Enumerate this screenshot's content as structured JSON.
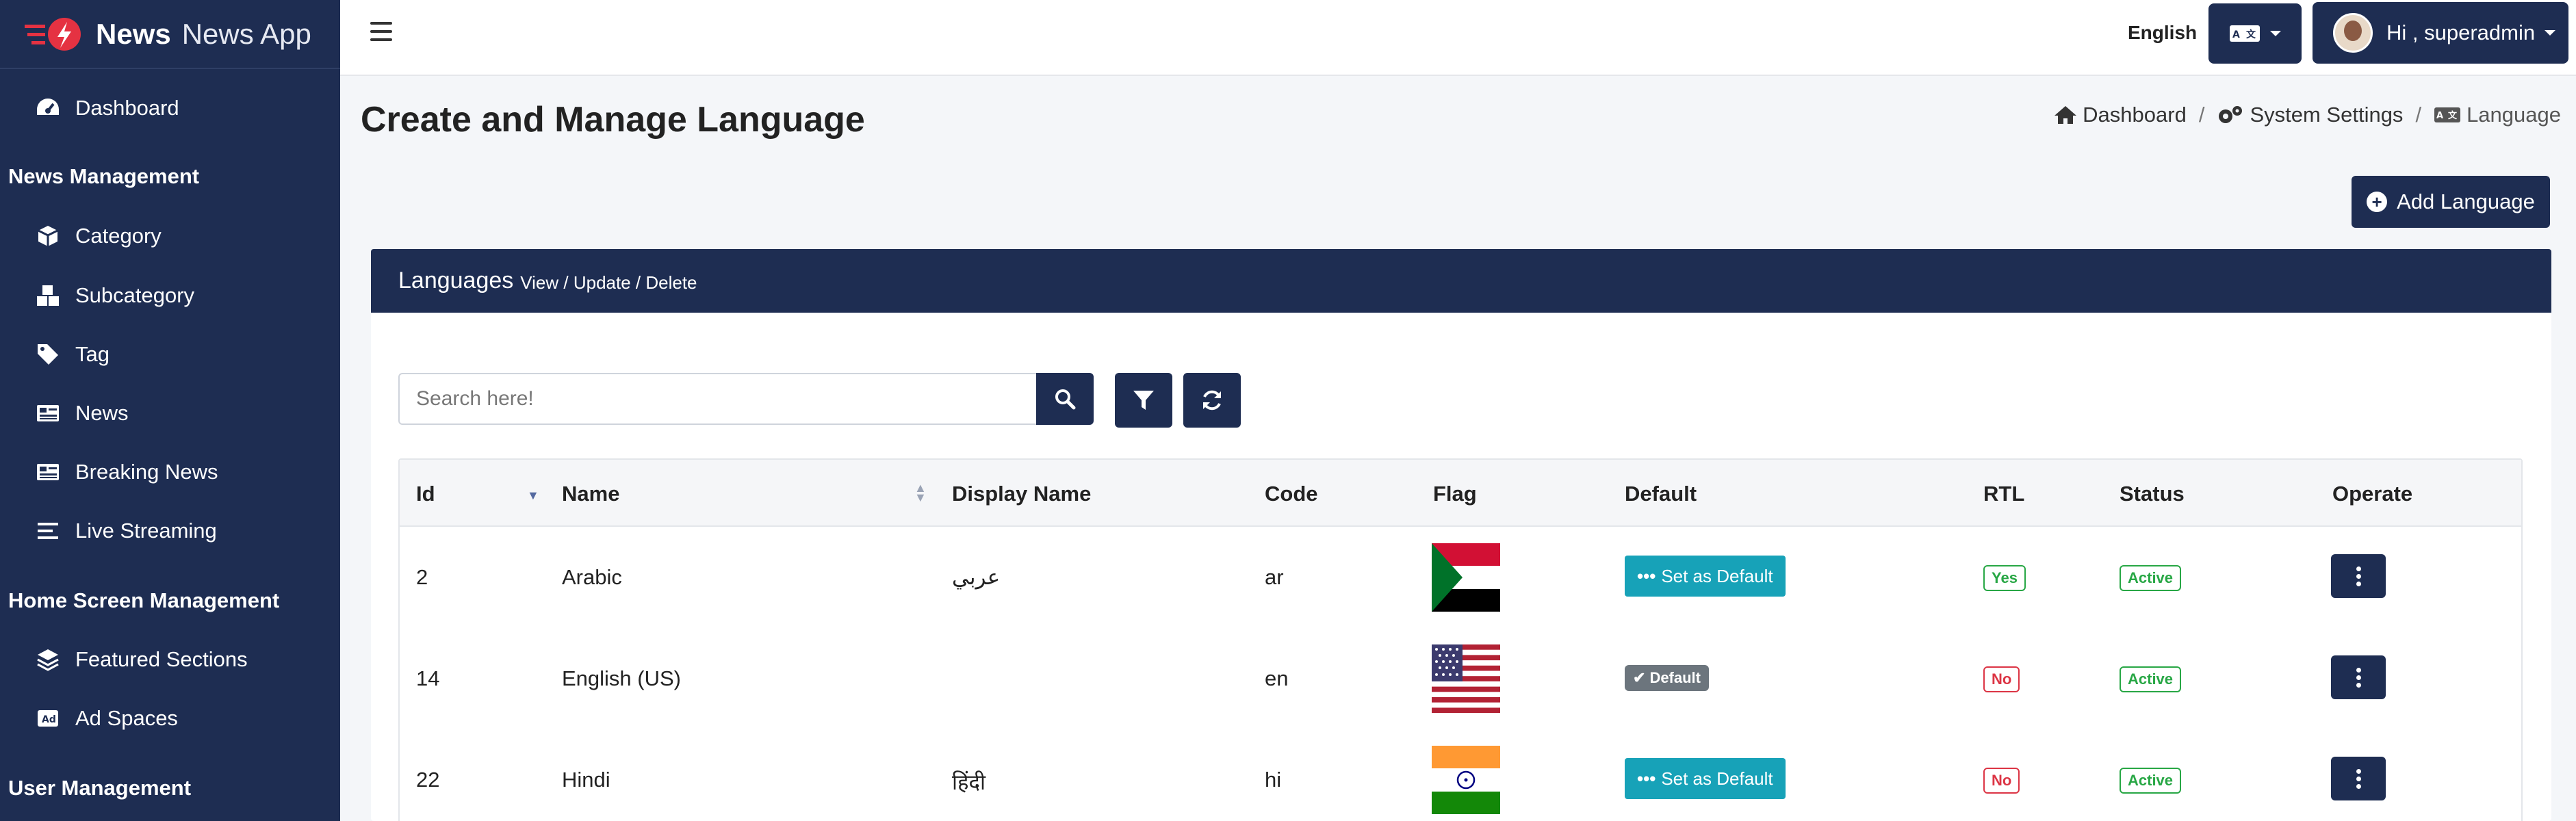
{
  "brand": {
    "name": "News",
    "subtitle": "News App"
  },
  "sidebar": {
    "items": [
      {
        "label": "Dashboard",
        "icon": "gauge-icon"
      },
      {
        "section": "News Management"
      },
      {
        "label": "Category",
        "icon": "cube-icon"
      },
      {
        "label": "Subcategory",
        "icon": "cubes-icon"
      },
      {
        "label": "Tag",
        "icon": "tag-icon"
      },
      {
        "label": "News",
        "icon": "newspaper-icon"
      },
      {
        "label": "Breaking News",
        "icon": "newspaper-icon"
      },
      {
        "label": "Live Streaming",
        "icon": "list-icon"
      },
      {
        "section": "Home Screen Management"
      },
      {
        "label": "Featured Sections",
        "icon": "layers-icon"
      },
      {
        "label": "Ad Spaces",
        "icon": "ad-icon"
      },
      {
        "section": "User Management"
      }
    ]
  },
  "topbar": {
    "language": "English",
    "user_greeting": "Hi , superadmin"
  },
  "page": {
    "title": "Create and Manage Language",
    "breadcrumb": [
      "Dashboard",
      "System Settings",
      "Language"
    ],
    "add_button": "Add Language"
  },
  "card": {
    "title": "Languages",
    "subtitle": "View / Update / Delete",
    "search_placeholder": "Search here!"
  },
  "table": {
    "columns": [
      "Id",
      "Name",
      "Display Name",
      "Code",
      "Flag",
      "Default",
      "RTL",
      "Status",
      "Operate"
    ],
    "rows": [
      {
        "id": "2",
        "name": "Arabic",
        "display_name": "عربي",
        "code": "ar",
        "flag": "sudan-flag",
        "default_label": "Set as Default",
        "is_default": false,
        "rtl": "Yes",
        "status": "Active"
      },
      {
        "id": "14",
        "name": "English (US)",
        "display_name": "",
        "code": "en",
        "flag": "us-flag",
        "default_label": "Default",
        "is_default": true,
        "rtl": "No",
        "status": "Active"
      },
      {
        "id": "22",
        "name": "Hindi",
        "display_name": "हिंदी",
        "code": "hi",
        "flag": "india-flag",
        "default_label": "Set as Default",
        "is_default": false,
        "rtl": "No",
        "status": "Active"
      }
    ]
  },
  "colors": {
    "primary": "#1e2d52",
    "info": "#17a2b8",
    "success": "#28a745",
    "danger": "#dc3545",
    "secondary": "#6c757d"
  }
}
